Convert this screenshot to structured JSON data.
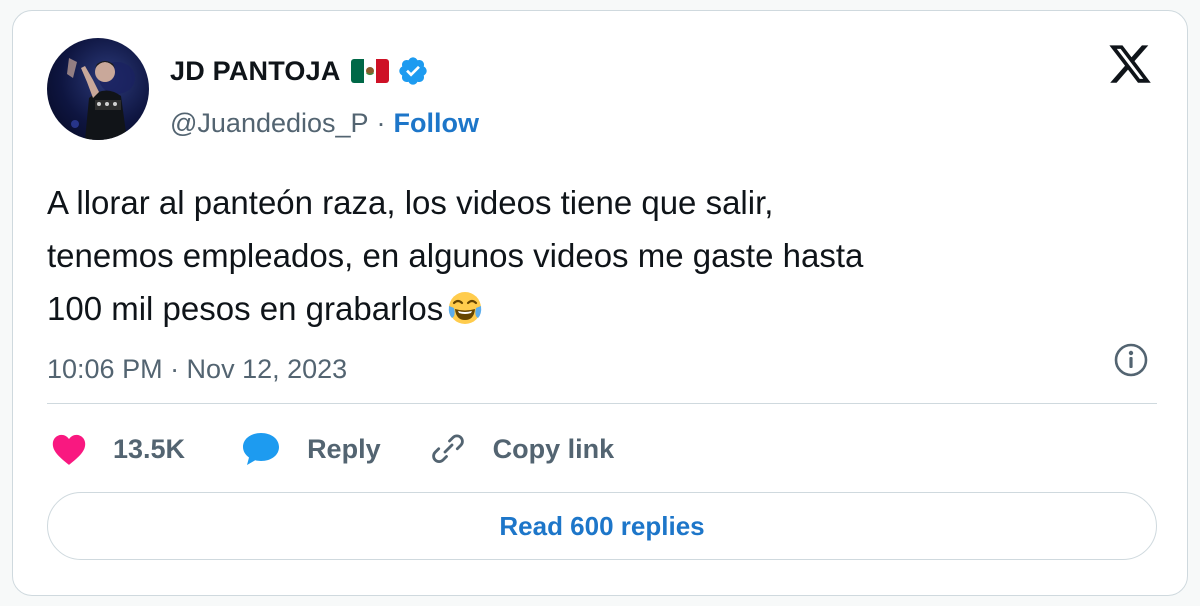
{
  "author": {
    "name": "JD PANTOJA",
    "flag_icon": "mexico-flag-icon",
    "verified_icon": "verified-badge-icon",
    "handle": "@Juandedios_P",
    "separator": "·",
    "follow_label": "Follow"
  },
  "tweet": {
    "lines": [
      "A llorar al panteón raza, los videos tiene que salir,",
      "tenemos empleados, en algunos videos me gaste hasta",
      "100 mil pesos en grabarlos"
    ],
    "emoji": "face-with-tears-of-joy-icon",
    "timestamp": "10:06 PM · Nov 12, 2023"
  },
  "actions": {
    "likes_count": "13.5K",
    "reply_label": "Reply",
    "copy_link_label": "Copy link"
  },
  "read_replies_label": "Read 600 replies",
  "colors": {
    "accent": "#1d76c9",
    "heart": "#f91880",
    "reply_bubble": "#1d9bf0",
    "muted_text": "#536471",
    "border": "#cfd9de"
  },
  "icons": {
    "platform_logo": "x-logo-icon",
    "info": "info-icon",
    "like": "heart-icon",
    "reply": "speech-bubble-icon",
    "copy_link": "link-icon"
  }
}
